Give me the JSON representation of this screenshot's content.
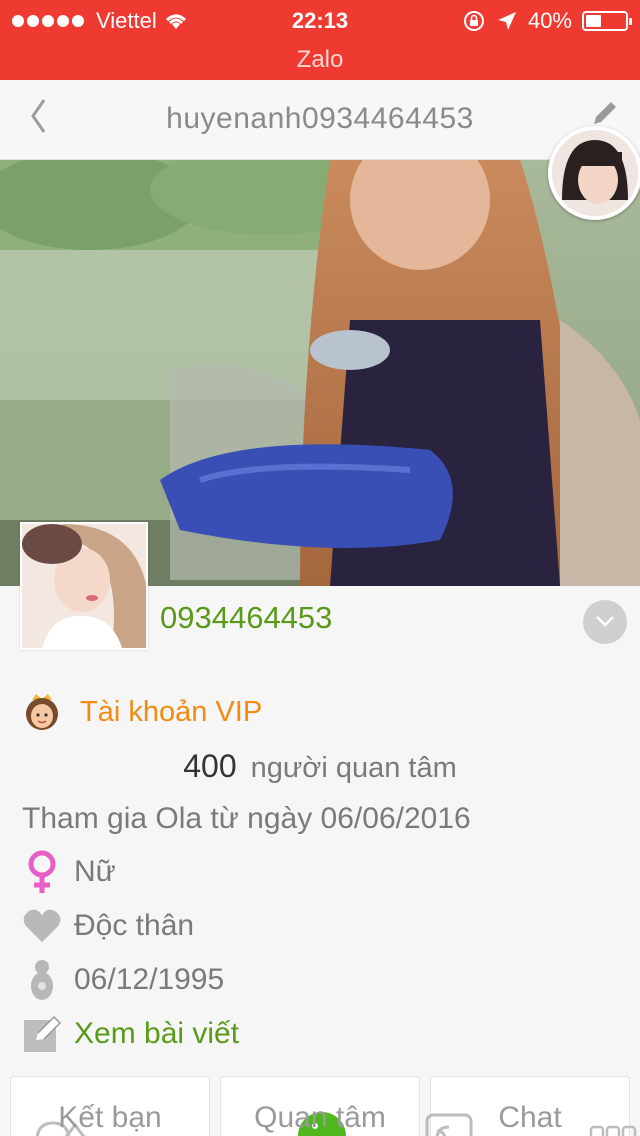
{
  "status_bar": {
    "carrier": "Viettel",
    "time": "22:13",
    "battery": "40%",
    "battery_level": 0.4,
    "app_name": "Zalo"
  },
  "nav": {
    "title": "huyenanh0934464453",
    "back_icon": "chevron-left-icon",
    "edit_icon": "pencil-icon"
  },
  "profile": {
    "phone": "0934464453",
    "vip_label": "Tài khoản VIP",
    "followers_count": "400",
    "followers_label": "người quan tâm",
    "joined": "Tham gia Ola từ ngày 06/06/2016",
    "gender": "Nữ",
    "relationship": "Độc thân",
    "birthday": "06/12/1995",
    "posts_link": "Xem bài viết"
  },
  "actions": [
    {
      "label": "Kết bạn",
      "icon": "add-friend-icon"
    },
    {
      "label": "Quan tâm",
      "icon": "follow-icon"
    },
    {
      "label": "Chat",
      "icon": "chat-icon"
    }
  ],
  "colors": {
    "brand_red": "#ee3a31",
    "green": "#5a9a1a",
    "orange": "#f28a14"
  }
}
